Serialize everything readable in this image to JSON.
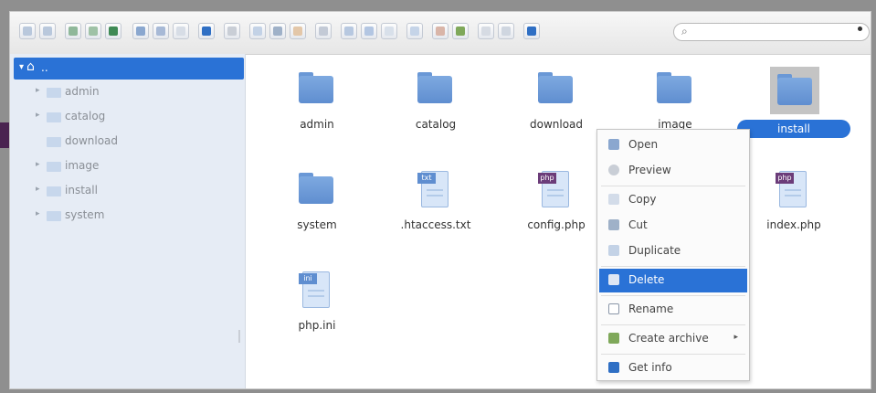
{
  "search": {
    "value": "",
    "placeholder": ""
  },
  "tree": {
    "root_label": "..",
    "items": [
      {
        "label": "admin",
        "expandable": true
      },
      {
        "label": "catalog",
        "expandable": true
      },
      {
        "label": "download",
        "expandable": false
      },
      {
        "label": "image",
        "expandable": true
      },
      {
        "label": "install",
        "expandable": true
      },
      {
        "label": "system",
        "expandable": true
      }
    ]
  },
  "files": [
    {
      "name": "admin",
      "type": "folder"
    },
    {
      "name": "catalog",
      "type": "folder"
    },
    {
      "name": "download",
      "type": "folder"
    },
    {
      "name": "image",
      "type": "folder"
    },
    {
      "name": "install",
      "type": "folder",
      "selected": true
    },
    {
      "name": "system",
      "type": "folder"
    },
    {
      "name": ".htaccess.txt",
      "type": "txt",
      "badge": "txt"
    },
    {
      "name": "config.php",
      "type": "php",
      "badge": "php"
    },
    {
      "name": "index.php",
      "type": "php",
      "badge": "php"
    },
    {
      "name": "php.ini",
      "type": "ini",
      "badge": "ini"
    }
  ],
  "context_menu": {
    "items": [
      {
        "label": "Open",
        "icon": "open-icon"
      },
      {
        "label": "Preview",
        "icon": "eye-icon"
      },
      {
        "label": "Copy",
        "icon": "copy-icon"
      },
      {
        "label": "Cut",
        "icon": "scissors-icon"
      },
      {
        "label": "Duplicate",
        "icon": "duplicate-icon"
      },
      {
        "label": "Delete",
        "icon": "trash-icon",
        "active": true
      },
      {
        "label": "Rename",
        "icon": "rename-icon"
      },
      {
        "label": "Create archive",
        "icon": "archive-icon",
        "submenu": true
      },
      {
        "label": "Get info",
        "icon": "info-icon"
      }
    ],
    "submenu_glyph": "▸"
  },
  "colors": {
    "accent": "#2a72d6",
    "sidebar_bg": "#e6ecf5",
    "folder": "#6a98d6",
    "php_badge": "#6b3c79"
  }
}
